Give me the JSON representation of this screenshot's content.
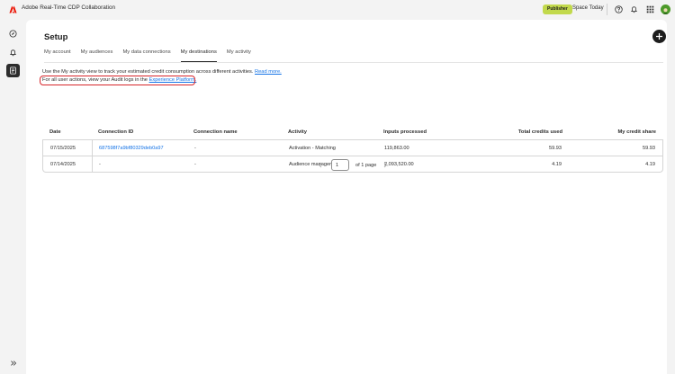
{
  "app": {
    "title": "Adobe Real-Time CDP Collaboration",
    "role_badge": "Publisher",
    "space_name": "Space Today",
    "colors": {
      "accent_badge": "#c2d94c",
      "link": "#1473e6",
      "highlight": "#d7262b"
    }
  },
  "rail": {
    "items": [
      {
        "icon": "compass-icon"
      },
      {
        "icon": "bell-icon"
      },
      {
        "icon": "document-list-icon",
        "active": true
      }
    ],
    "expand_icon": "double-chevron-right-icon"
  },
  "page": {
    "title": "Setup",
    "add_icon": "plus-icon"
  },
  "tabs": [
    {
      "label": "My account"
    },
    {
      "label": "My audiences"
    },
    {
      "label": "My data connections"
    },
    {
      "label": "My destinations",
      "selected": true
    },
    {
      "label": "My activity"
    }
  ],
  "info": {
    "line1_text": "Use the My activity view to track your estimated credit consumption across different activities.",
    "line1_link": "Read more.",
    "line2_text": "For all user actions, view your Audit logs in the",
    "line2_link": "Experience Platform."
  },
  "table": {
    "columns": [
      "Date",
      "Connection ID",
      "Connection name",
      "Activity",
      "Inputs processed",
      "Total credits used",
      "My credit share"
    ],
    "rows": [
      [
        "07/15/2025",
        "687598f7a9bf80329deb0a97",
        "-",
        "Activation - Matching",
        "119,863.00",
        "59.93",
        "59.93"
      ],
      [
        "07/14/2025",
        "-",
        "-",
        "Audience management",
        "2,093,520.00",
        "4.19",
        "4.19"
      ]
    ]
  },
  "pagination": {
    "current_page": "1",
    "of_label": "of 1 page"
  }
}
